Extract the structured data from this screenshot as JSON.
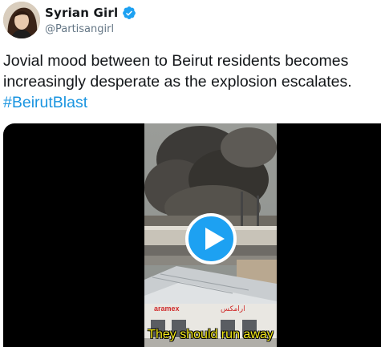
{
  "tweet": {
    "display_name": "Syrian Girl",
    "handle": "@Partisangirl",
    "text_line1": "Jovial mood between to Beirut residents becomes",
    "text_line2": "increasingly desperate as the explosion escalates.",
    "hashtag": "#BeirutBlast"
  },
  "video": {
    "caption": "They should run away"
  },
  "icons": {
    "verified": "verified-badge-icon",
    "play": "play-icon"
  },
  "colors": {
    "verified": "#1da1f2",
    "play_button": "#1da1f2",
    "hashtag": "#1b95e0",
    "caption": "#f5ea1a"
  }
}
